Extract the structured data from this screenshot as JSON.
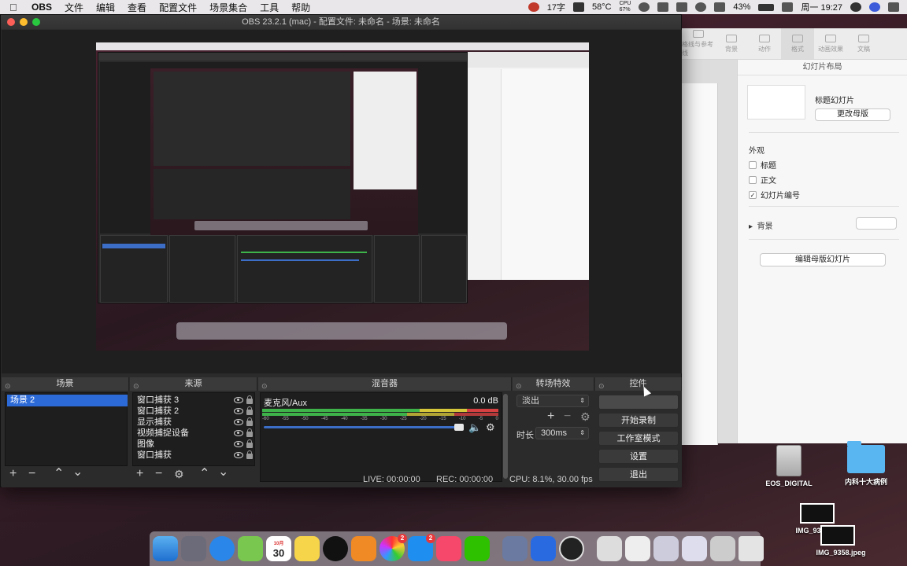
{
  "menubar": {
    "apple": "",
    "items": [
      "OBS",
      "文件",
      "编辑",
      "查看",
      "配置文件",
      "场景集合",
      "工具",
      "帮助"
    ],
    "tray": {
      "chars": "17字",
      "temp": "58°C",
      "cpu_label": "CPU",
      "cpu": "67%",
      "battery": "43%",
      "clock": "周一 19:27"
    }
  },
  "obs": {
    "title": "OBS 23.2.1 (mac) - 配置文件: 未命名 - 场景: 未命名",
    "scenes": {
      "header": "场景",
      "items": [
        "场景 2"
      ]
    },
    "sources": {
      "header": "来源",
      "items": [
        "窗口捕获 3",
        "窗口捕获 2",
        "显示捕获",
        "视频捕捉设备",
        "图像",
        "窗口捕获"
      ]
    },
    "mixer": {
      "header": "混音器",
      "track_name": "麦克风/Aux",
      "track_level": "0.0 dB",
      "scale": [
        "-60",
        "-55",
        "-50",
        "-45",
        "-40",
        "-35",
        "-30",
        "-25",
        "-20",
        "-15",
        "-10",
        "-5",
        "0"
      ]
    },
    "transitions": {
      "header": "转场特效",
      "selected": "淡出",
      "duration_label": "时长",
      "duration": "300ms"
    },
    "controls": {
      "header": "控件",
      "buttons": [
        "",
        "开始录制",
        "工作室模式",
        "设置",
        "退出"
      ]
    },
    "status": {
      "live": "LIVE: 00:00:00",
      "rec": "REC: 00:00:00",
      "cpu": "CPU: 8.1%, 30.00 fps"
    }
  },
  "keynote": {
    "toolbar": [
      "格线与参考线",
      "背景",
      "动作",
      "格式",
      "动画效果",
      "文稿"
    ],
    "panel_title": "幻灯片布局",
    "layout_name": "标题幻灯片",
    "change_master": "更改母版",
    "appearance": "外观",
    "options": [
      {
        "label": "标题",
        "checked": false
      },
      {
        "label": "正文",
        "checked": false
      },
      {
        "label": "幻灯片编号",
        "checked": true
      }
    ],
    "background": "背景",
    "edit_master": "编辑母版幻灯片"
  },
  "desktop": {
    "drive": "EOS_DIGITAL",
    "folder": "内科十大病例",
    "image1": "IMG_9357.jpeg",
    "image2": "IMG_9358.jpeg"
  },
  "dock": {
    "calendar_day": "30",
    "calendar_month": "10月",
    "badges": [
      "2",
      "2"
    ]
  },
  "colors": {
    "obs_bg": "#2b2b2b",
    "selected": "#2c6ad8",
    "meter_green": "#3db34a",
    "meter_yellow": "#d6c63a",
    "meter_red": "#d64040"
  }
}
